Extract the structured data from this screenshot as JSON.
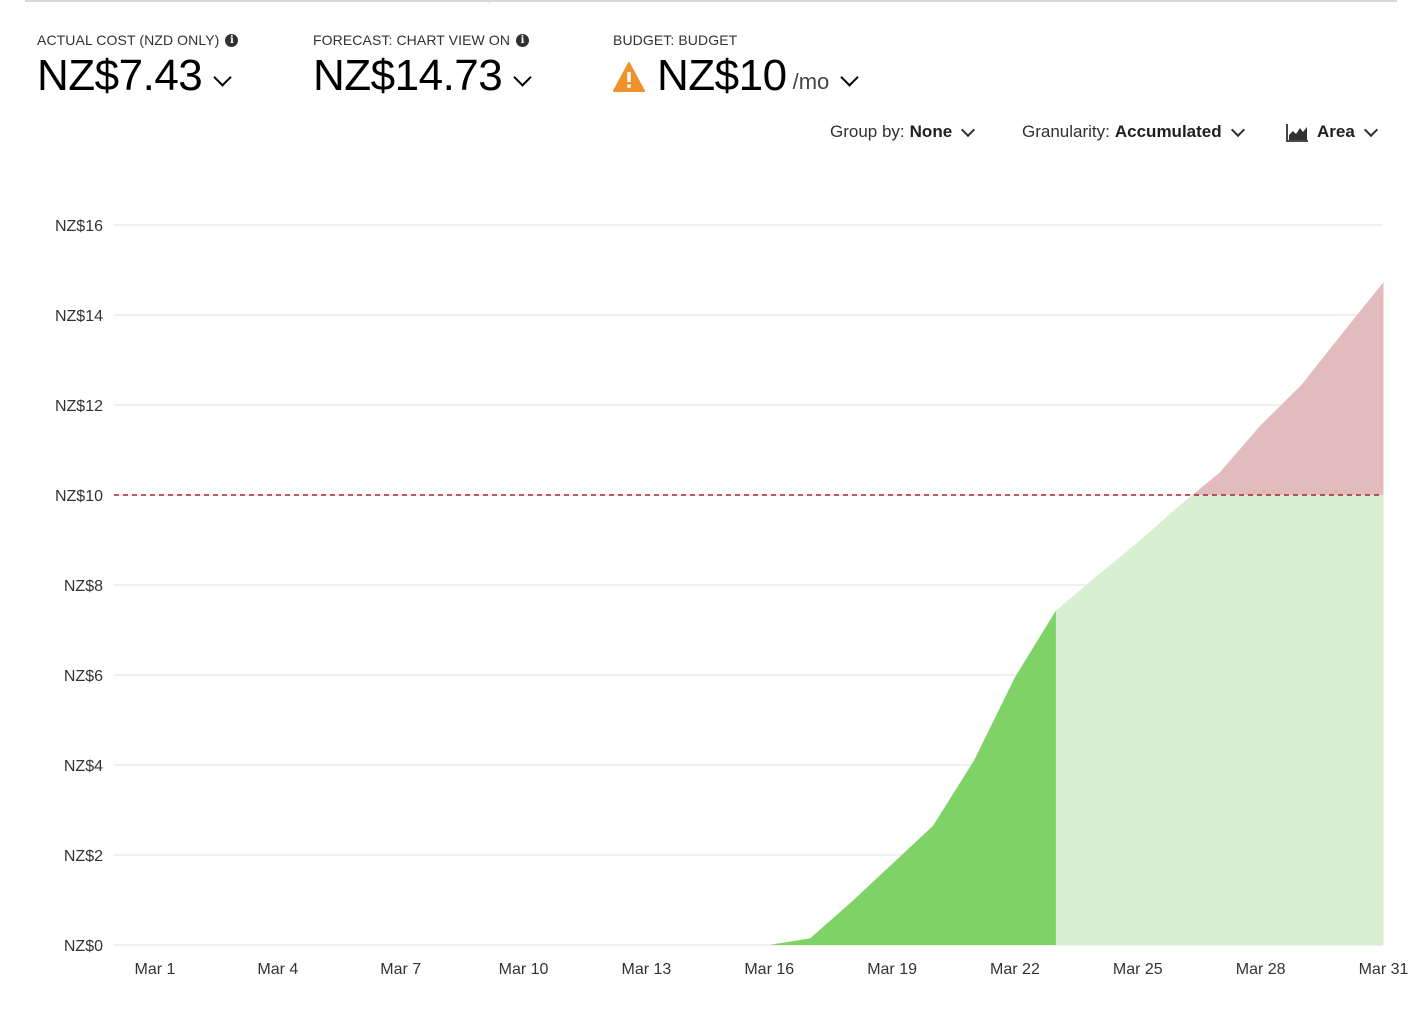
{
  "kpis": [
    {
      "label": "ACTUAL COST (NZD ONLY)",
      "value": "NZ$7.43",
      "has_info": true
    },
    {
      "label": "FORECAST: CHART VIEW ON",
      "value": "NZ$14.73",
      "has_info": true
    },
    {
      "label": "BUDGET: BUDGET",
      "value": "NZ$10",
      "unit": "/mo",
      "icon": "warning-icon"
    }
  ],
  "controls": {
    "group_by_label": "Group by:",
    "group_by_value": "None",
    "granularity_label": "Granularity:",
    "granularity_value": "Accumulated",
    "chart_type_value": "Area",
    "chart_type_icon": "area-chart-icon"
  },
  "colors": {
    "actual": "#7ed266",
    "forecast": "#d8f0d1",
    "over_budget": "#e2bcbc",
    "budget_line": "#a4262c",
    "warning": "#f0922b"
  },
  "chart_data": {
    "type": "area",
    "x_labels": [
      "Mar 1",
      "Mar 4",
      "Mar 7",
      "Mar 10",
      "Mar 13",
      "Mar 16",
      "Mar 19",
      "Mar 22",
      "Mar 25",
      "Mar 28",
      "Mar 31"
    ],
    "y_ticks": [
      "NZ$0",
      "NZ$2",
      "NZ$4",
      "NZ$6",
      "NZ$8",
      "NZ$10",
      "NZ$12",
      "NZ$14",
      "NZ$16"
    ],
    "ylim": [
      0,
      16
    ],
    "xlim": [
      0,
      31
    ],
    "budget": 10,
    "series": [
      {
        "values": [
          [
            16,
            0
          ],
          [
            17,
            0.15
          ],
          [
            18,
            0.95
          ],
          [
            19,
            1.8
          ],
          [
            20,
            2.65
          ],
          [
            21,
            4.1
          ],
          [
            22,
            5.95
          ],
          [
            23,
            7.43
          ]
        ]
      },
      {
        "values": [
          [
            23,
            7.43
          ],
          [
            24,
            8.2
          ],
          [
            25,
            8.95
          ],
          [
            26,
            9.75
          ],
          [
            27,
            10.5
          ],
          [
            28,
            11.55
          ],
          [
            29,
            12.45
          ],
          [
            30,
            13.6
          ],
          [
            31,
            14.73
          ]
        ]
      }
    ],
    "grid": true
  }
}
